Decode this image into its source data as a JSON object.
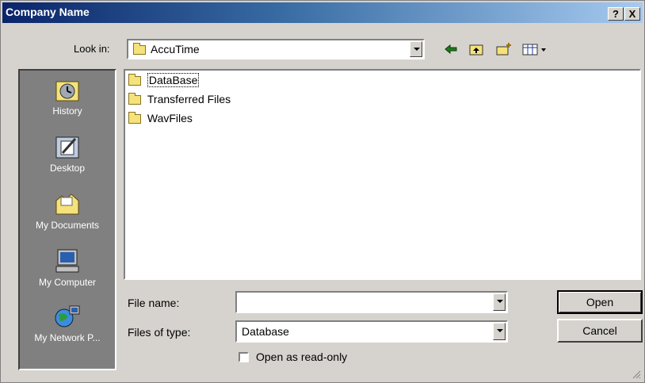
{
  "window": {
    "title": "Company Name",
    "help_glyph": "?",
    "close_glyph": "X"
  },
  "lookin": {
    "label": "Look in:",
    "value": "AccuTime"
  },
  "toolbar": {
    "icons": [
      "back-icon",
      "up-folder-icon",
      "new-folder-icon",
      "view-menu-icon"
    ]
  },
  "places": [
    {
      "label": "History",
      "icon": "history-icon"
    },
    {
      "label": "Desktop",
      "icon": "desktop-icon"
    },
    {
      "label": "My Documents",
      "icon": "my-documents-icon"
    },
    {
      "label": "My Computer",
      "icon": "my-computer-icon"
    },
    {
      "label": "My Network P...",
      "icon": "my-network-icon"
    }
  ],
  "files": [
    {
      "name": "DataBase",
      "selected": true
    },
    {
      "name": "Transferred Files",
      "selected": false
    },
    {
      "name": "WavFiles",
      "selected": false
    }
  ],
  "filename": {
    "label": "File name:",
    "value": ""
  },
  "filetype": {
    "label": "Files of type:",
    "value": "Database"
  },
  "readonly": {
    "label": "Open as read-only",
    "checked": false
  },
  "buttons": {
    "open": "Open",
    "cancel": "Cancel"
  },
  "colors": {
    "title_start": "#0a246a",
    "title_end": "#a6caf0",
    "face": "#d6d3ce",
    "places_bg": "#808080"
  }
}
